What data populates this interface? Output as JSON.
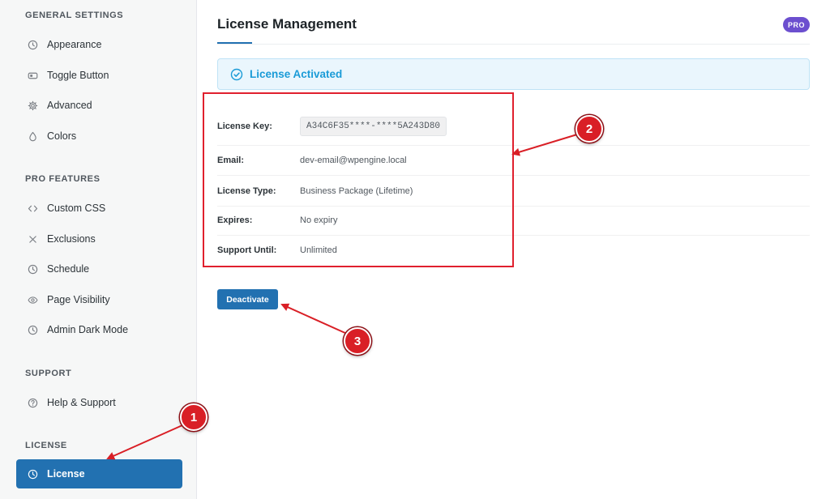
{
  "sidebar": {
    "sections": [
      {
        "title": "GENERAL SETTINGS",
        "items": [
          {
            "label": "Appearance",
            "icon": "palette-icon"
          },
          {
            "label": "Toggle Button",
            "icon": "toggle-icon"
          },
          {
            "label": "Advanced",
            "icon": "gear-icon"
          },
          {
            "label": "Colors",
            "icon": "droplet-icon"
          }
        ]
      },
      {
        "title": "PRO FEATURES",
        "items": [
          {
            "label": "Custom CSS",
            "icon": "code-icon"
          },
          {
            "label": "Exclusions",
            "icon": "close-icon"
          },
          {
            "label": "Schedule",
            "icon": "clock-icon"
          },
          {
            "label": "Page Visibility",
            "icon": "eye-icon"
          },
          {
            "label": "Admin Dark Mode",
            "icon": "clock-icon"
          }
        ]
      },
      {
        "title": "SUPPORT",
        "items": [
          {
            "label": "Help & Support",
            "icon": "help-icon"
          }
        ]
      },
      {
        "title": "LICENSE",
        "items": [
          {
            "label": "License",
            "icon": "clock-icon",
            "active": true
          }
        ]
      }
    ]
  },
  "header": {
    "title": "License Management",
    "badge": "PRO"
  },
  "notice": {
    "text": "License Activated"
  },
  "license": {
    "rows": [
      {
        "label": "License Key:",
        "value": "A34C6F35****-****5A243D80"
      },
      {
        "label": "Email:",
        "value": "dev-email@wpengine.local"
      },
      {
        "label": "License Type:",
        "value": "Business Package (Lifetime)"
      },
      {
        "label": "Expires:",
        "value": "No expiry"
      },
      {
        "label": "Support Until:",
        "value": "Unlimited"
      }
    ]
  },
  "actions": {
    "deactivate_label": "Deactivate"
  },
  "callouts": [
    "1",
    "2",
    "3"
  ],
  "colors": {
    "accent": "#2271b1",
    "annotation": "#d91f26",
    "pro_badge": "#6c4fcf",
    "notice_text": "#1a9bd7"
  }
}
